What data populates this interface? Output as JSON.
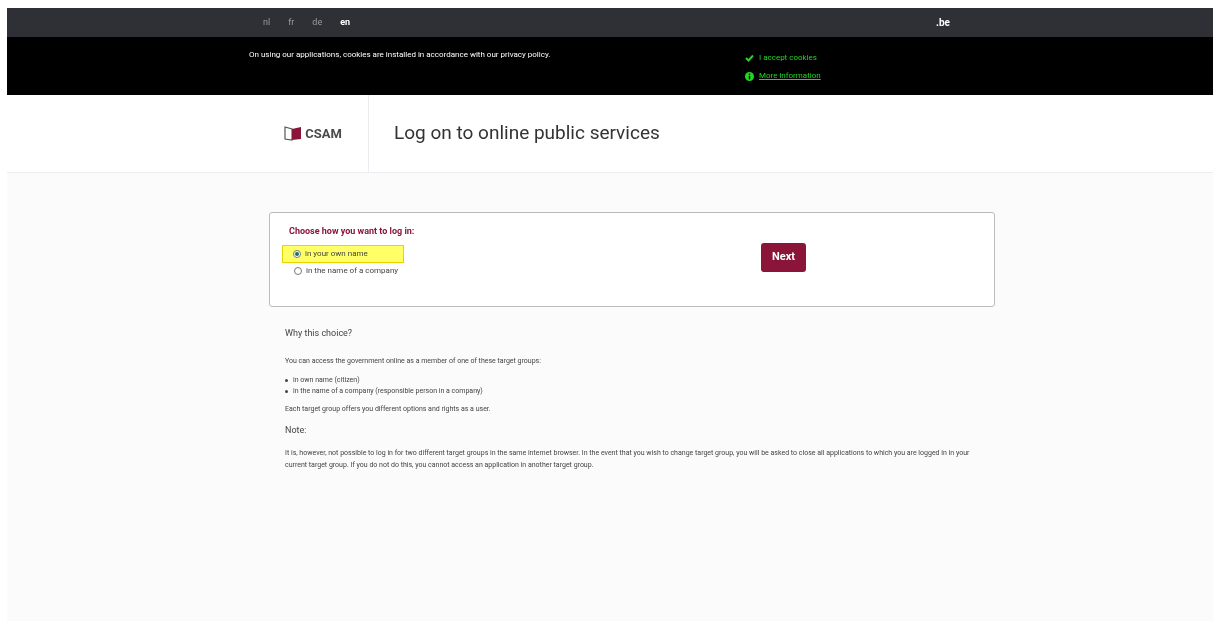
{
  "languages": [
    {
      "label": "nl",
      "selected": false
    },
    {
      "label": "fr",
      "selected": false
    },
    {
      "label": "de",
      "selected": false
    },
    {
      "label": "en",
      "selected": true
    }
  ],
  "domain": ".be",
  "cookie_banner": {
    "message": "On using our applications, cookies are installed in accordance with our privacy policy.",
    "accept": "I accept cookies",
    "more_info": "More information"
  },
  "header": {
    "logo": "CSAM",
    "title": "Log on to online public services"
  },
  "login_box": {
    "heading": "Choose how you want to log in:",
    "options": [
      {
        "label": "in your own name",
        "selected": true,
        "highlighted": true
      },
      {
        "label": "in the name of a company",
        "selected": false,
        "highlighted": false
      }
    ],
    "button": "Next"
  },
  "info": {
    "heading": "Why this choice?",
    "intro": "You can access the government online as a member of one of these target groups:",
    "bullets": [
      "in own name (citizen)",
      "in the name of a company (responsible person in a company)"
    ],
    "closing": "Each target group offers you different options and rights as a user.",
    "note_heading": "Note:",
    "note": "It is, however, not possible to log in for two different target groups in the same internet browser. In the event that you wish to change target group, you will be asked to close all applications to which you are logged in in your current target group. If you do not do this, you cannot access an application in another target group."
  }
}
